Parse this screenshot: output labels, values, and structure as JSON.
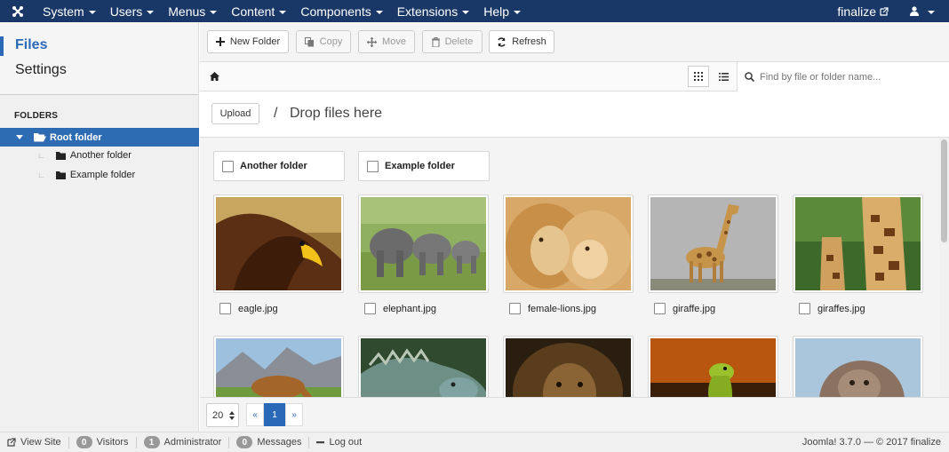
{
  "navbar": {
    "menus": [
      {
        "label": "System"
      },
      {
        "label": "Users"
      },
      {
        "label": "Menus"
      },
      {
        "label": "Content"
      },
      {
        "label": "Components"
      },
      {
        "label": "Extensions"
      },
      {
        "label": "Help"
      }
    ],
    "site_link": "finalize",
    "bg_color": "#1a3867"
  },
  "sidebar": {
    "links": [
      {
        "label": "Files",
        "active": true
      },
      {
        "label": "Settings",
        "active": false
      }
    ],
    "folders_heading": "FOLDERS",
    "tree": {
      "root": "Root folder",
      "children": [
        "Another folder",
        "Example folder"
      ]
    }
  },
  "toolbar": {
    "new_folder": "New Folder",
    "copy": "Copy",
    "move": "Move",
    "delete": "Delete",
    "refresh": "Refresh"
  },
  "search": {
    "placeholder": "Find by file or folder name..."
  },
  "upload": {
    "button": "Upload",
    "separator": "/",
    "drop_text": "Drop files here"
  },
  "browser": {
    "folders": [
      "Another folder",
      "Example folder"
    ],
    "files": [
      {
        "name": "eagle.jpg",
        "icon": "eagle-thumbnail"
      },
      {
        "name": "elephant.jpg",
        "icon": "elephant-thumbnail"
      },
      {
        "name": "female-lions.jpg",
        "icon": "lions-thumbnail"
      },
      {
        "name": "giraffe.jpg",
        "icon": "giraffe-thumbnail"
      },
      {
        "name": "giraffes.jpg",
        "icon": "giraffes-thumbnail"
      },
      {
        "name": "",
        "icon": "horse-thumbnail"
      },
      {
        "name": "",
        "icon": "iguana-thumbnail"
      },
      {
        "name": "",
        "icon": "lion-thumbnail"
      },
      {
        "name": "",
        "icon": "lizard-thumbnail"
      },
      {
        "name": "",
        "icon": "monkey-thumbnail"
      }
    ]
  },
  "pagination": {
    "per_page": "20",
    "prev": "«",
    "current": "1",
    "next": "»",
    "accent": "#2a69b8"
  },
  "status": {
    "view_site": "View Site",
    "visitors_count": "0",
    "visitors_label": "Visitors",
    "admin_count": "1",
    "admin_label": "Administrator",
    "messages_count": "0",
    "messages_label": "Messages",
    "logout": "Log out",
    "version": "Joomla! 3.7.0 — © 2017 finalize"
  }
}
